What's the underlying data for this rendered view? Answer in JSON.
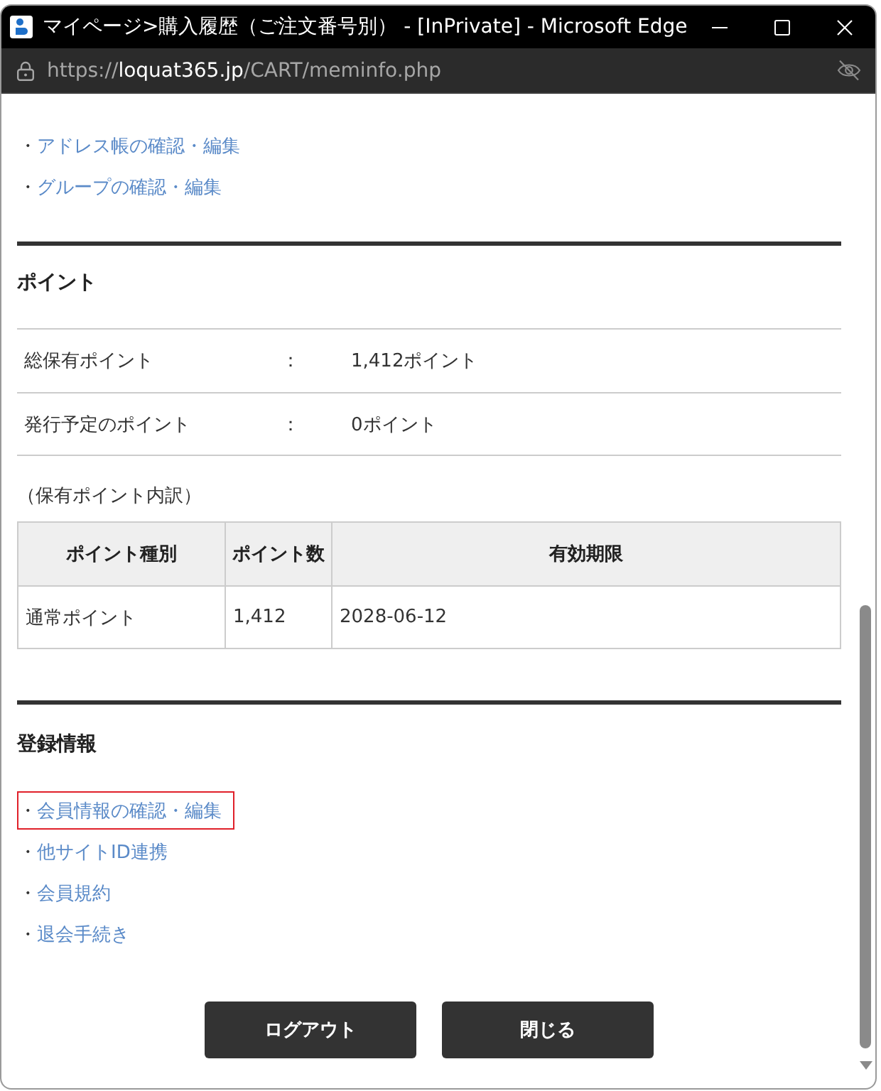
{
  "window": {
    "title": "マイページ>購入履歴（ご注文番号別） - [InPrivate] - Microsoft Edge"
  },
  "address_bar": {
    "url_scheme": "https://",
    "url_host": "loquat365.jp",
    "url_path": "/CART/meminfo.php"
  },
  "top_links": [
    {
      "bullet": "・",
      "label": "アドレス帳の確認・編集",
      "highlighted": false
    },
    {
      "bullet": "・",
      "label": "グループの確認・編集",
      "highlighted": false
    }
  ],
  "points": {
    "heading": "ポイント",
    "rows": [
      {
        "label": "総保有ポイント",
        "separator": "：",
        "value": "1,412ポイント"
      },
      {
        "label": "発行予定のポイント",
        "separator": "：",
        "value": "0ポイント"
      }
    ],
    "breakdown_caption": "（保有ポイント内訳）",
    "table": {
      "columns": [
        "ポイント種別",
        "ポイント数",
        "有効期限"
      ],
      "rows": [
        [
          "通常ポイント",
          "1,412",
          "2028-06-12"
        ]
      ]
    }
  },
  "registration": {
    "heading": "登録情報",
    "links": [
      {
        "bullet": "・",
        "label": "会員情報の確認・編集",
        "highlighted": true
      },
      {
        "bullet": "・",
        "label": "他サイトID連携",
        "highlighted": false
      },
      {
        "bullet": "・",
        "label": "会員規約",
        "highlighted": false
      },
      {
        "bullet": "・",
        "label": "退会手続き",
        "highlighted": false
      }
    ]
  },
  "buttons": [
    {
      "label": "ログアウト"
    },
    {
      "label": "閉じる"
    }
  ]
}
